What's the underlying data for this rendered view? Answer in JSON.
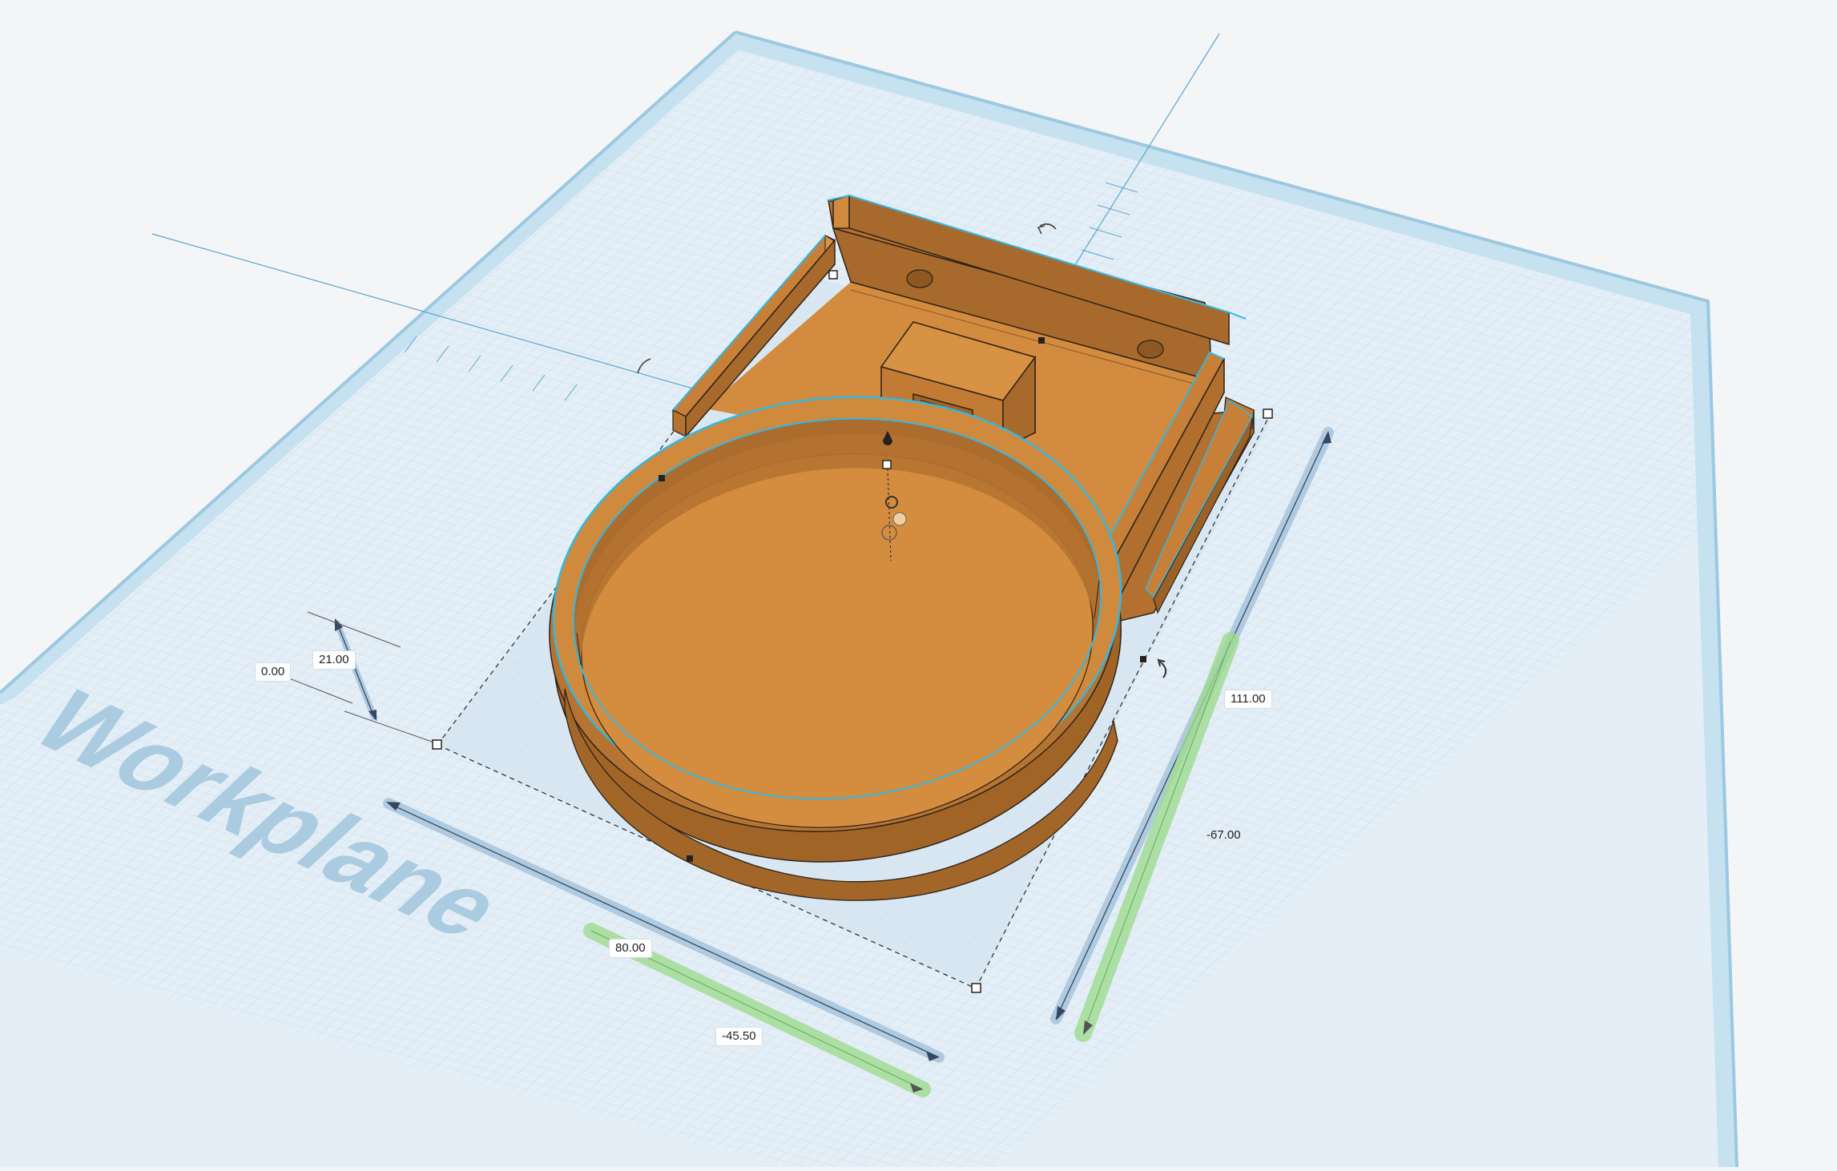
{
  "workplane": {
    "label": "Workplane",
    "colors": {
      "background": "#f4f5f7",
      "grid_fill": "#e3eff7",
      "grid_line": "#bcd6e8",
      "grid_major": "#9fc2db",
      "border": "#b7d8ec",
      "label": "#a9cbe0"
    }
  },
  "model": {
    "colors": {
      "body": "#d18a3e",
      "body_light": "#d89244",
      "body_dark": "#b06f2e",
      "body_darker": "#9c6127",
      "edge": "#2d2218",
      "selection": "#34b8e3"
    }
  },
  "dimensions": {
    "height": "21.00",
    "elevation": "0.00",
    "width": "80.00",
    "x_position": "-45.50",
    "length": "111.00",
    "y_position": "-67.00"
  },
  "ruler_colors": {
    "size": "#a7c4dd",
    "position": "#9fdc8f"
  },
  "icons": {
    "rotate": "rotate-arrow-icon",
    "lift": "lift-cone-icon",
    "handle": "resize-handle-icon"
  }
}
